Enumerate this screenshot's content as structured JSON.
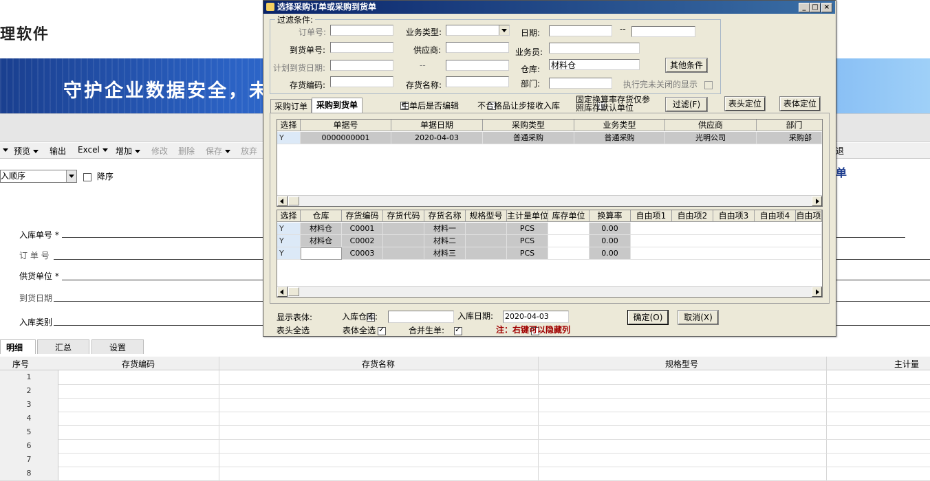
{
  "app": {
    "title_fragment": "理软件",
    "banner_text": "守护企业数据安全，未"
  },
  "toolbar": {
    "items": [
      "预览",
      "输出",
      "Excel",
      "增加",
      "修改",
      "删除",
      "保存",
      "放弃",
      "退出"
    ]
  },
  "sort": {
    "value": "入顺序",
    "desc_label": "降序"
  },
  "right_title": "单",
  "form": {
    "receipt_no": "入库单号",
    "order_no": "订 单 号",
    "supplier": "供货单位",
    "arrival_date": "到货日期",
    "receipt_type": "入库类别",
    "required": "*"
  },
  "bottom_tabs": [
    "明细",
    "汇总",
    "设置"
  ],
  "main_grid": {
    "headers": [
      "序号",
      "存货编码",
      "存货名称",
      "规格型号",
      "主计量"
    ],
    "rows": [
      "1",
      "2",
      "3",
      "4",
      "5",
      "6",
      "7",
      "8"
    ]
  },
  "dialog": {
    "title": "选择采购订单或采购到货单",
    "filter_legend": "过滤条件:",
    "labels": {
      "order_no": "订单号:",
      "biz_type": "业务类型:",
      "date": "日期:",
      "date_sep": "--",
      "arrival_no": "到货单号:",
      "supplier": "供应商:",
      "salesman": "业务员:",
      "plan_date": "计划到货日期:",
      "plan_sep": "--",
      "warehouse": "仓库:",
      "inv_code": "存货编码:",
      "inv_name": "存货名称:",
      "dept": "部门:",
      "show_done": "执行完未关闭的显示"
    },
    "values": {
      "warehouse": "材料仓"
    },
    "buttons": {
      "other": "其他条件",
      "filter": "过滤(F)",
      "head_locate": "表头定位",
      "body_locate": "表体定位",
      "ok": "确定(O)",
      "cancel": "取消(X)"
    },
    "tabs": [
      "采购订单",
      "采购到货单"
    ],
    "options": {
      "edit_after": "生单后是否编辑",
      "unqualified": "不合格品让步接收入库",
      "fixed_rate_1": "固定换算率存货仅参",
      "fixed_rate_2": "照库存默认单位"
    },
    "head_grid": {
      "headers": [
        "选择",
        "单据号",
        "单据日期",
        "采购类型",
        "业务类型",
        "供应商",
        "部门"
      ],
      "rows": [
        {
          "sel": "Y",
          "no": "0000000001",
          "date": "2020-04-03",
          "ptype": "普通采购",
          "btype": "普通采购",
          "supplier": "光明公司",
          "dept": "采购部"
        }
      ]
    },
    "body_grid": {
      "headers": [
        "选择",
        "仓库",
        "存货编码",
        "存货代码",
        "存货名称",
        "规格型号",
        "主计量单位",
        "库存单位",
        "换算率",
        "自由项1",
        "自由项2",
        "自由项3",
        "自由项4",
        "自由项"
      ],
      "rows": [
        {
          "sel": "Y",
          "wh": "材料仓",
          "code": "C0001",
          "name": "材料一",
          "unit": "PCS",
          "rate": "0.00"
        },
        {
          "sel": "Y",
          "wh": "材料仓",
          "code": "C0002",
          "name": "材料二",
          "unit": "PCS",
          "rate": "0.00"
        },
        {
          "sel": "Y",
          "wh": "",
          "code": "C0003",
          "name": "材料三",
          "unit": "PCS",
          "rate": "0.00"
        }
      ]
    },
    "footer": {
      "show_body": "显示表体:",
      "in_wh": "入库仓库:",
      "in_date": "入库日期:",
      "in_date_value": "2020-04-03",
      "head_all": "表头全选",
      "body_all": "表体全选",
      "merge": "合并生单:",
      "note": "注：右键可以隐藏列"
    }
  }
}
